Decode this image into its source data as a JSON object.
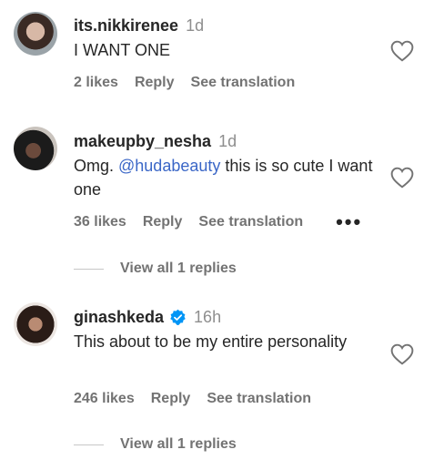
{
  "comments": [
    {
      "username": "its.nikkirenee",
      "time": "1d",
      "text": "I WANT ONE",
      "likes": "2 likes",
      "reply": "Reply",
      "translate": "See translation"
    },
    {
      "username": "makeupby_nesha",
      "time": "1d",
      "text_before": "Omg. ",
      "mention": "@hudabeauty",
      "text_after": " this is so cute I want one",
      "likes": "36 likes",
      "reply": "Reply",
      "translate": "See translation",
      "more": "•••",
      "view_replies": "View all 1 replies"
    },
    {
      "username": "ginashkeda",
      "time": "16h",
      "text": "This about to be my entire personality",
      "likes": "246 likes",
      "reply": "Reply",
      "translate": "See translation",
      "view_replies": "View all 1 replies"
    }
  ],
  "colors": {
    "mention": "#3b67c7",
    "verified": "#0095f6",
    "meta": "#737373"
  },
  "icons": [
    "heart-outline-icon",
    "verified-badge-icon",
    "more-options-icon"
  ]
}
